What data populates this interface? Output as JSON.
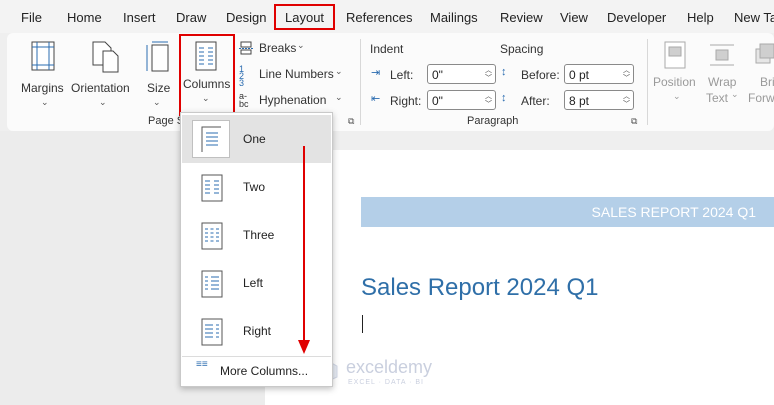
{
  "menubar": {
    "items": [
      "File",
      "Home",
      "Insert",
      "Draw",
      "Design",
      "Layout",
      "References",
      "Mailings",
      "Review",
      "View",
      "Developer",
      "Help",
      "New Ta"
    ],
    "active": "Layout"
  },
  "ribbon": {
    "page_setup": {
      "margins": "Margins",
      "orientation": "Orientation",
      "size": "Size",
      "columns": "Columns",
      "breaks": "Breaks",
      "line_numbers": "Line Numbers",
      "hyphenation": "Hyphenation",
      "group_label": "Page S"
    },
    "paragraph": {
      "indent_heading": "Indent",
      "spacing_heading": "Spacing",
      "left_label": "Left:",
      "left_value": "0\"",
      "right_label": "Right:",
      "right_value": "0\"",
      "before_label": "Before:",
      "before_value": "0 pt",
      "after_label": "After:",
      "after_value": "8 pt",
      "group_label": "Paragraph"
    },
    "arrange": {
      "position": "Position",
      "wrap_1": "Wrap",
      "wrap_2": "Text",
      "bring_1": "Bri",
      "bring_2": "Forw"
    }
  },
  "columns_dropdown": {
    "items": [
      "One",
      "Two",
      "Three",
      "Left",
      "Right"
    ],
    "selected": "One",
    "more": "More Columns..."
  },
  "document": {
    "banner_text": "SALES REPORT 2024 Q1",
    "heading": "Sales Report 2024 Q1"
  },
  "watermark": {
    "brand": "exceldemy",
    "tagline": "EXCEL · DATA · BI"
  },
  "colors": {
    "highlight": "#e00000",
    "heading": "#2f6fa8",
    "banner_bg": "#b4cfe8",
    "icon_accent": "#2b6cb0"
  }
}
